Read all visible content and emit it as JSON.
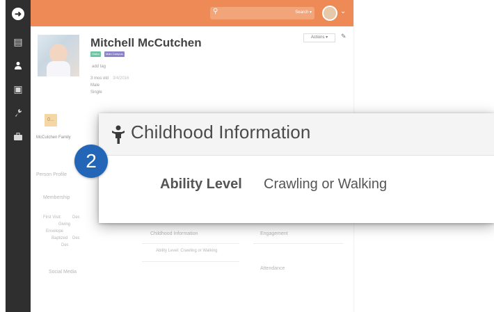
{
  "sidebar": {
    "items": [
      {
        "icon": "rock-logo-icon",
        "glyph": "➜"
      },
      {
        "icon": "page-icon",
        "glyph": "▤"
      },
      {
        "icon": "person-icon",
        "glyph": "👤"
      },
      {
        "icon": "money-icon",
        "glyph": "▣"
      },
      {
        "icon": "wrench-icon",
        "glyph": "🔧"
      },
      {
        "icon": "briefcase-icon",
        "glyph": "▰"
      }
    ]
  },
  "header": {
    "search_button_label": "Search ▾",
    "search_glyph": "⚲",
    "chevron": "⌄"
  },
  "profile": {
    "name": "Mitchell McCutchen",
    "badges": [
      "Visitor",
      "Main Campus"
    ],
    "add_tag": "add tag",
    "age": "3 mos old",
    "birthdate": "3/4/2016",
    "gender": "Male",
    "marital_status": "Single",
    "actions_label": "Actions ▾",
    "edit_glyph": "✎"
  },
  "family": {
    "name": "McCutchen Family",
    "icon_label": "0..."
  },
  "background": {
    "person_profile": "Person Profile",
    "membership": "Membership",
    "childhood_info": "Childhood Information",
    "ability_row": "Ability Level: Crawling or Walking",
    "social_media": "Social Media",
    "engagement": "Engagement",
    "attendance": "Attendance",
    "group_rows": [
      "First Visit:",
      "Giving",
      "Envelope",
      "Baptized"
    ],
    "placeholder_dates": [
      "Dec",
      "Dec",
      "Dec"
    ]
  },
  "callout": {
    "step_number": "2",
    "title": "Childhood Information",
    "field_label": "Ability Level",
    "field_value": "Crawling or Walking"
  },
  "colors": {
    "accent": "#ee8a55",
    "sidebar": "#2f2f2f",
    "step_badge": "#2366b8"
  }
}
